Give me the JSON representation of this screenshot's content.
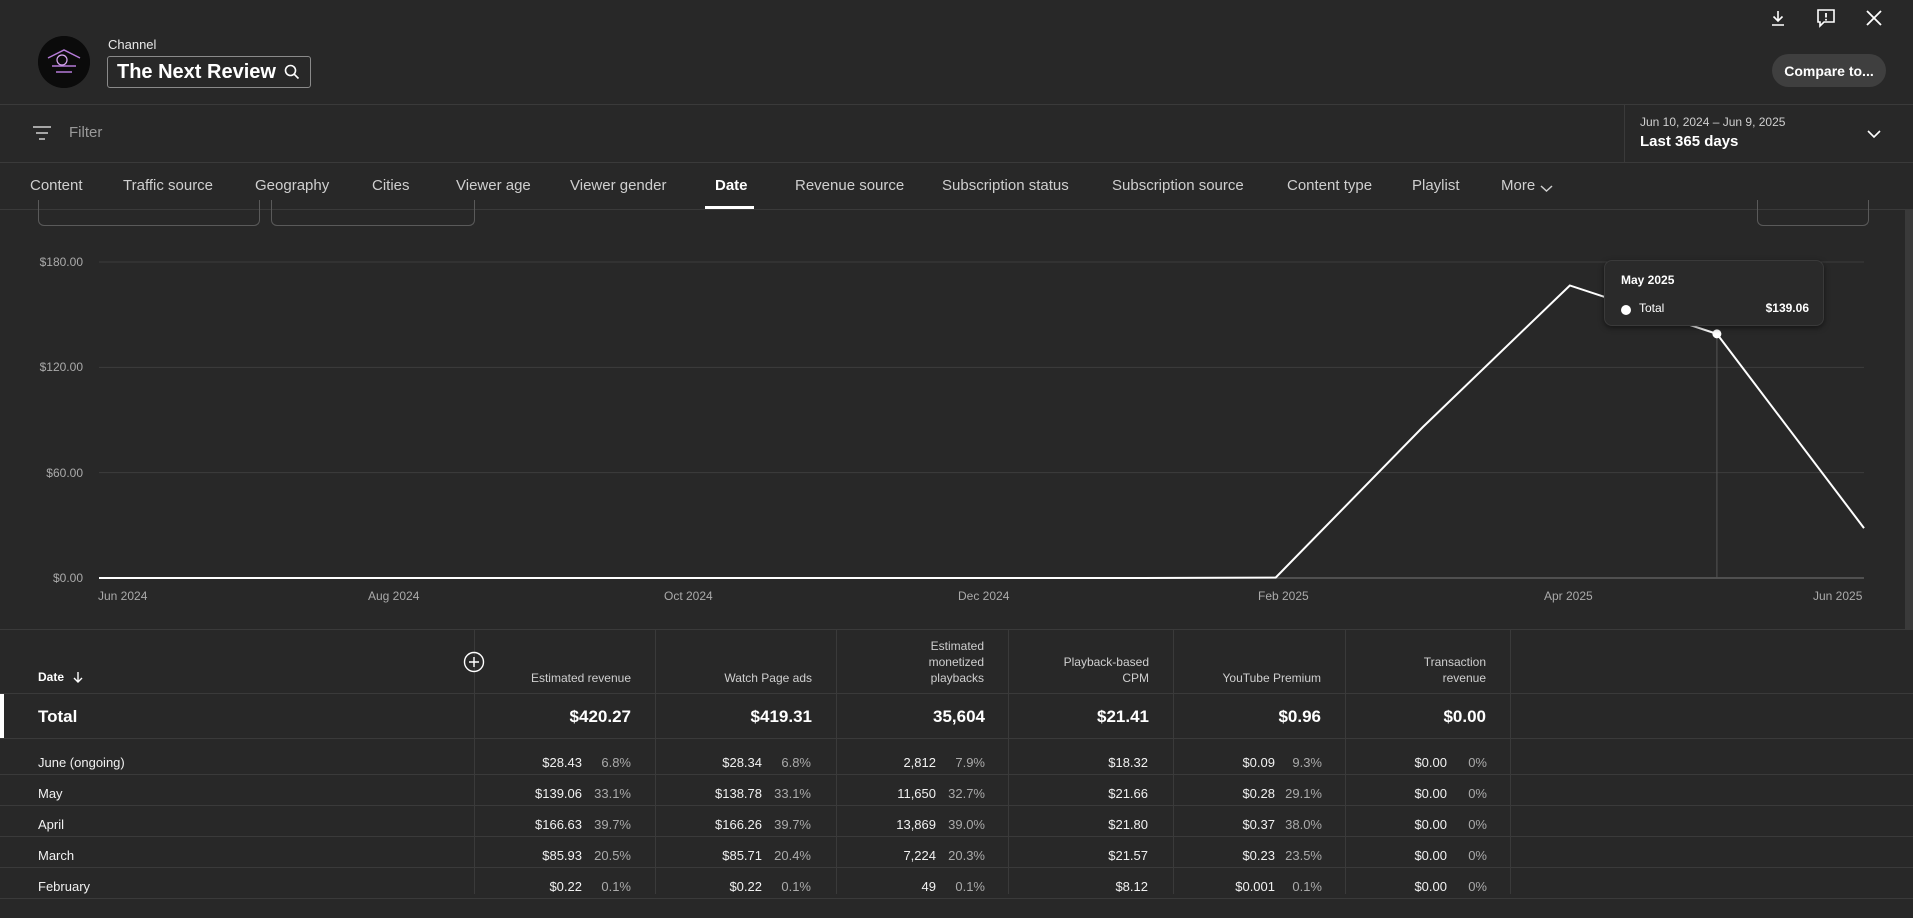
{
  "header": {
    "channel_label": "Channel",
    "channel_name": "The Next Review",
    "compare_button": "Compare to..."
  },
  "filter": {
    "placeholder": "Filter",
    "date_range": "Jun 10, 2024 – Jun 9, 2025",
    "date_period": "Last 365 days"
  },
  "tabs": [
    {
      "label": "Content"
    },
    {
      "label": "Traffic source"
    },
    {
      "label": "Geography"
    },
    {
      "label": "Cities"
    },
    {
      "label": "Viewer age"
    },
    {
      "label": "Viewer gender"
    },
    {
      "label": "Date",
      "active": true
    },
    {
      "label": "Revenue source"
    },
    {
      "label": "Subscription status"
    },
    {
      "label": "Subscription source"
    },
    {
      "label": "Content type"
    },
    {
      "label": "Playlist"
    },
    {
      "label": "More"
    }
  ],
  "chart_data": {
    "type": "line",
    "y_ticks": [
      "$180.00",
      "$120.00",
      "$60.00",
      "$0.00"
    ],
    "x_ticks": [
      "Jun 2024",
      "Aug 2024",
      "Oct 2024",
      "Dec 2024",
      "Feb 2025",
      "Apr 2025",
      "Jun 2025"
    ],
    "ylim": [
      0,
      180
    ],
    "x": [
      "Jun 2024",
      "Jul 2024",
      "Aug 2024",
      "Sep 2024",
      "Oct 2024",
      "Nov 2024",
      "Dec 2024",
      "Jan 2025",
      "Feb 2025",
      "Mar 2025",
      "Apr 2025",
      "May 2025",
      "Jun 2025"
    ],
    "series": [
      {
        "values": [
          0,
          0,
          0,
          0,
          0,
          0,
          0,
          0,
          0.22,
          85.93,
          166.63,
          139.06,
          28.43
        ]
      }
    ],
    "grid": true,
    "tooltip": {
      "title": "May 2025",
      "label": "Total",
      "value": "$139.06"
    }
  },
  "table": {
    "date_header": "Date",
    "columns": [
      [
        "Estimated revenue"
      ],
      [
        "Watch Page ads"
      ],
      [
        "Estimated",
        "monetized",
        "playbacks"
      ],
      [
        "Playback-based",
        "CPM"
      ],
      [
        "YouTube Premium"
      ],
      [
        "Transaction",
        "revenue"
      ]
    ],
    "total": {
      "label": "Total",
      "values": [
        "$420.27",
        "$419.31",
        "35,604",
        "$21.41",
        "$0.96",
        "$0.00"
      ]
    },
    "rows": [
      {
        "label": "June (ongoing)",
        "cells": [
          [
            "$28.43",
            "6.8%"
          ],
          [
            "$28.34",
            "6.8%"
          ],
          [
            "2,812",
            "7.9%"
          ],
          [
            "$18.32",
            ""
          ],
          [
            "$0.09",
            "9.3%"
          ],
          [
            "$0.00",
            "0%"
          ]
        ]
      },
      {
        "label": "May",
        "cells": [
          [
            "$139.06",
            "33.1%"
          ],
          [
            "$138.78",
            "33.1%"
          ],
          [
            "11,650",
            "32.7%"
          ],
          [
            "$21.66",
            ""
          ],
          [
            "$0.28",
            "29.1%"
          ],
          [
            "$0.00",
            "0%"
          ]
        ]
      },
      {
        "label": "April",
        "cells": [
          [
            "$166.63",
            "39.7%"
          ],
          [
            "$166.26",
            "39.7%"
          ],
          [
            "13,869",
            "39.0%"
          ],
          [
            "$21.80",
            ""
          ],
          [
            "$0.37",
            "38.0%"
          ],
          [
            "$0.00",
            "0%"
          ]
        ]
      },
      {
        "label": "March",
        "cells": [
          [
            "$85.93",
            "20.5%"
          ],
          [
            "$85.71",
            "20.4%"
          ],
          [
            "7,224",
            "20.3%"
          ],
          [
            "$21.57",
            ""
          ],
          [
            "$0.23",
            "23.5%"
          ],
          [
            "$0.00",
            "0%"
          ]
        ]
      },
      {
        "label": "February",
        "cells": [
          [
            "$0.22",
            "0.1%"
          ],
          [
            "$0.22",
            "0.1%"
          ],
          [
            "49",
            "0.1%"
          ],
          [
            "$8.12",
            ""
          ],
          [
            "$0.001",
            "0.1%"
          ],
          [
            "$0.00",
            "0%"
          ]
        ]
      }
    ]
  }
}
